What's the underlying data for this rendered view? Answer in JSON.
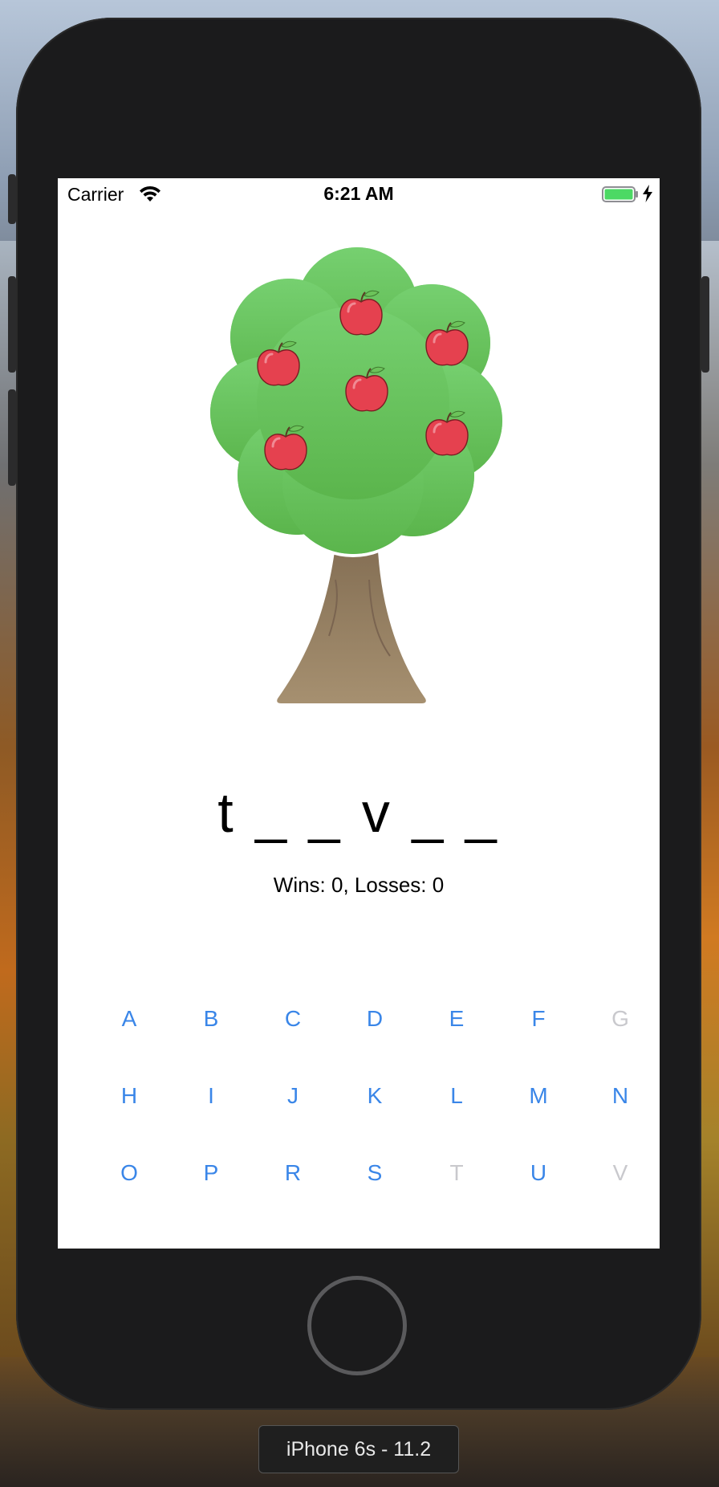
{
  "status_bar": {
    "carrier": "Carrier",
    "time": "6:21 AM",
    "wifi_icon": "wifi-icon",
    "battery_icon": "battery-icon",
    "charging_icon": "bolt-icon"
  },
  "game": {
    "apples_remaining": 6,
    "puzzle_word": "t _ _ v _ _",
    "score_text": "Wins: 0, Losses: 0"
  },
  "keyboard": {
    "rows": [
      [
        {
          "letter": "A",
          "enabled": true
        },
        {
          "letter": "B",
          "enabled": true
        },
        {
          "letter": "C",
          "enabled": true
        },
        {
          "letter": "D",
          "enabled": true
        },
        {
          "letter": "E",
          "enabled": true
        },
        {
          "letter": "F",
          "enabled": true
        },
        {
          "letter": "G",
          "enabled": false
        }
      ],
      [
        {
          "letter": "H",
          "enabled": true
        },
        {
          "letter": "I",
          "enabled": true
        },
        {
          "letter": "J",
          "enabled": true
        },
        {
          "letter": "K",
          "enabled": true
        },
        {
          "letter": "L",
          "enabled": true
        },
        {
          "letter": "M",
          "enabled": true
        },
        {
          "letter": "N",
          "enabled": true
        }
      ],
      [
        {
          "letter": "O",
          "enabled": true
        },
        {
          "letter": "P",
          "enabled": true
        },
        {
          "letter": "R",
          "enabled": true
        },
        {
          "letter": "S",
          "enabled": true
        },
        {
          "letter": "T",
          "enabled": false
        },
        {
          "letter": "U",
          "enabled": true
        },
        {
          "letter": "V",
          "enabled": false
        }
      ]
    ],
    "accent_color": "#3a86e8",
    "disabled_color": "#c9c9cd"
  },
  "simulator": {
    "device_label": "iPhone 6s - 11.2"
  }
}
